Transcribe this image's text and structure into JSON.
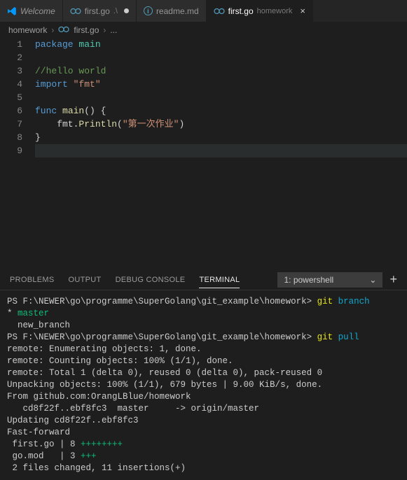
{
  "tabs": [
    {
      "icon": "vscode",
      "label": "Welcome",
      "desc": ""
    },
    {
      "icon": "go",
      "label": "first.go",
      "desc": ".\\",
      "modified": true
    },
    {
      "icon": "info",
      "label": "readme.md",
      "desc": ""
    },
    {
      "icon": "go",
      "label": "first.go",
      "desc": "homework",
      "active": true,
      "closable": true
    }
  ],
  "breadcrumbs": {
    "folder": "homework",
    "file": "first.go",
    "ellipsis": "..."
  },
  "code": {
    "lines": [
      {
        "n": "1",
        "segments": [
          {
            "t": "package ",
            "c": "tok-keyword"
          },
          {
            "t": "main",
            "c": "tok-type"
          }
        ]
      },
      {
        "n": "2",
        "segments": []
      },
      {
        "n": "3",
        "segments": [
          {
            "t": "//hello world",
            "c": "tok-comment"
          }
        ]
      },
      {
        "n": "4",
        "segments": [
          {
            "t": "import ",
            "c": "tok-keyword"
          },
          {
            "t": "\"fmt\"",
            "c": "tok-string"
          }
        ]
      },
      {
        "n": "5",
        "segments": []
      },
      {
        "n": "6",
        "segments": [
          {
            "t": "func ",
            "c": "tok-keyword"
          },
          {
            "t": "main",
            "c": "tok-func"
          },
          {
            "t": "() {",
            "c": "tok-default"
          }
        ]
      },
      {
        "n": "7",
        "segments": [
          {
            "t": "    fmt.",
            "c": "tok-default"
          },
          {
            "t": "Println",
            "c": "tok-func"
          },
          {
            "t": "(",
            "c": "tok-default"
          },
          {
            "t": "\"第一次作业\"",
            "c": "tok-string"
          },
          {
            "t": ")",
            "c": "tok-default"
          }
        ]
      },
      {
        "n": "8",
        "segments": [
          {
            "t": "}",
            "c": "tok-default"
          }
        ]
      },
      {
        "n": "9",
        "segments": [],
        "current": true
      }
    ]
  },
  "panel": {
    "tabs": {
      "problems": "PROBLEMS",
      "output": "OUTPUT",
      "debug_console": "DEBUG CONSOLE",
      "terminal": "TERMINAL"
    },
    "dropdown": "1: powershell"
  },
  "terminal": {
    "lines": [
      [
        {
          "t": "PS F:\\NEWER\\go\\programme\\SuperGolang\\git_example\\homework> "
        },
        {
          "t": "git ",
          "c": "t-yellow"
        },
        {
          "t": "branch",
          "c": "t-cyan"
        }
      ],
      [
        {
          "t": "* "
        },
        {
          "t": "master",
          "c": "t-green"
        }
      ],
      [
        {
          "t": "  new_branch"
        }
      ],
      [
        {
          "t": "PS F:\\NEWER\\go\\programme\\SuperGolang\\git_example\\homework> "
        },
        {
          "t": "git ",
          "c": "t-yellow"
        },
        {
          "t": "pull",
          "c": "t-cyan"
        }
      ],
      [
        {
          "t": "remote: Enumerating objects: 1, done."
        }
      ],
      [
        {
          "t": "remote: Counting objects: 100% (1/1), done."
        }
      ],
      [
        {
          "t": "remote: Total 1 (delta 0), reused 0 (delta 0), pack-reused 0"
        }
      ],
      [
        {
          "t": "Unpacking objects: 100% (1/1), 679 bytes | 9.00 KiB/s, done."
        }
      ],
      [
        {
          "t": "From github.com:OrangLBlue/homework"
        }
      ],
      [
        {
          "t": "   cd8f22f..ebf8fc3  master     -> origin/master"
        }
      ],
      [
        {
          "t": "Updating cd8f22f..ebf8fc3"
        }
      ],
      [
        {
          "t": "Fast-forward"
        }
      ],
      [
        {
          "t": " first.go | 8 "
        },
        {
          "t": "++++++++",
          "c": "t-green"
        }
      ],
      [
        {
          "t": " go.mod   | 3 "
        },
        {
          "t": "+++",
          "c": "t-green"
        }
      ],
      [
        {
          "t": " 2 files changed, 11 insertions(+)"
        }
      ]
    ]
  }
}
